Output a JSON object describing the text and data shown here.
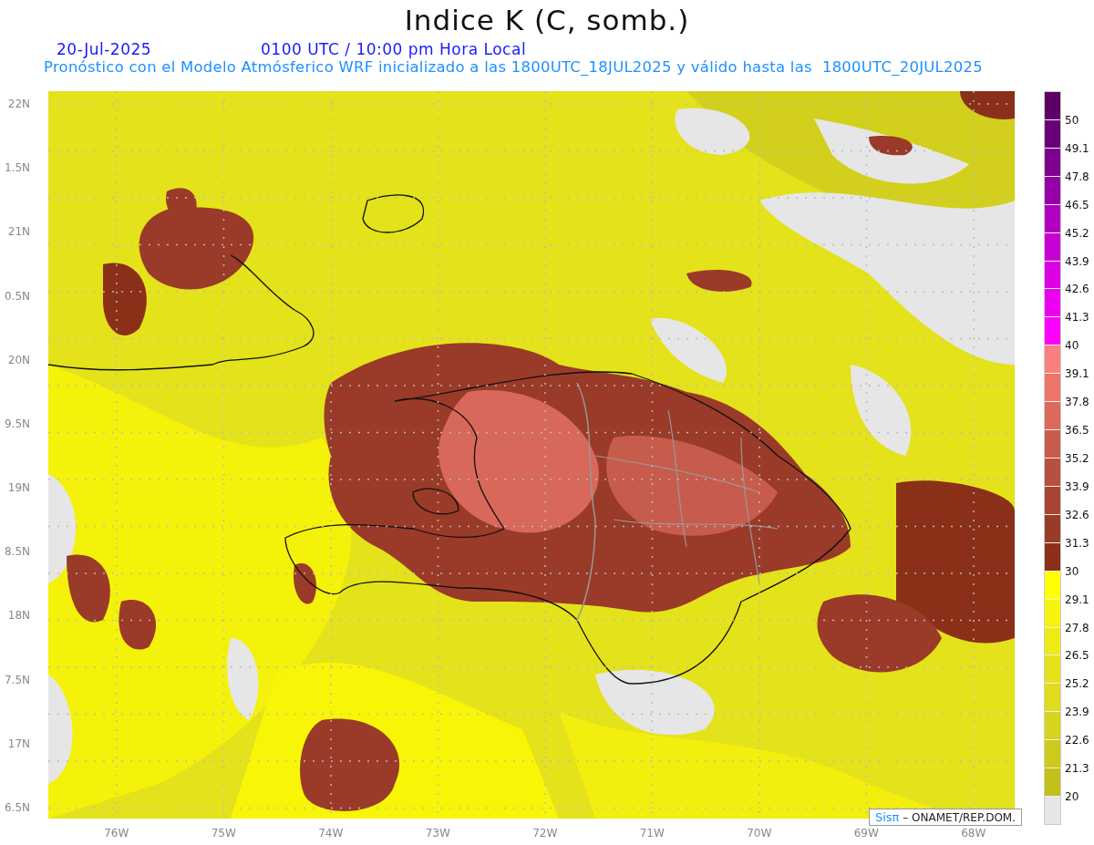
{
  "title": "Indice K (C, somb.)",
  "date": "20-Jul-2025",
  "time": "0100 UTC / 10:00 pm Hora Local",
  "subtitle": "Pronóstico con el Modelo Atmósferico WRF inicializado a las 1800UTC_18JUL2025 y válido hasta las  1800UTC_20JUL2025",
  "y_axis": [
    "22N",
    "1.5N",
    "21N",
    "0.5N",
    "20N",
    "9.5N",
    "19N",
    "8.5N",
    "18N",
    "7.5N",
    "17N",
    "6.5N"
  ],
  "x_axis": [
    "76W",
    "75W",
    "74W",
    "73W",
    "72W",
    "71W",
    "70W",
    "69W",
    "68W"
  ],
  "credit": {
    "brand": "Sisπ",
    "text": "– ONAMET/REP.DOM."
  },
  "colorbar": [
    {
      "color": "#5c0066",
      "label": "50"
    },
    {
      "color": "#6a0078",
      "label": "49.1"
    },
    {
      "color": "#7d008e",
      "label": "47.8"
    },
    {
      "color": "#9600a8",
      "label": "46.5"
    },
    {
      "color": "#b000c0",
      "label": "45.2"
    },
    {
      "color": "#c800d4",
      "label": "43.9"
    },
    {
      "color": "#dc00e4",
      "label": "42.6"
    },
    {
      "color": "#ec00f0",
      "label": "41.3"
    },
    {
      "color": "#ff00ff",
      "label": "40"
    },
    {
      "color": "#fa8080",
      "label": "39.1"
    },
    {
      "color": "#ee7468",
      "label": "37.8"
    },
    {
      "color": "#dc6a5c",
      "label": "36.5"
    },
    {
      "color": "#c85c4c",
      "label": "35.2"
    },
    {
      "color": "#b65040",
      "label": "33.9"
    },
    {
      "color": "#a84434",
      "label": "32.6"
    },
    {
      "color": "#9a3a28",
      "label": "31.3"
    },
    {
      "color": "#8a3018",
      "label": "30"
    },
    {
      "color": "#ffff00",
      "label": "29.1"
    },
    {
      "color": "#f6f30c",
      "label": "27.8"
    },
    {
      "color": "#eeea14",
      "label": "26.5"
    },
    {
      "color": "#e6e21a",
      "label": "25.2"
    },
    {
      "color": "#dedc1c",
      "label": "23.9"
    },
    {
      "color": "#d6d41c",
      "label": "22.6"
    },
    {
      "color": "#cdca1c",
      "label": "21.3"
    },
    {
      "color": "#c2c01a",
      "label": "20"
    },
    {
      "color": "#e6e6e6"
    }
  ]
}
